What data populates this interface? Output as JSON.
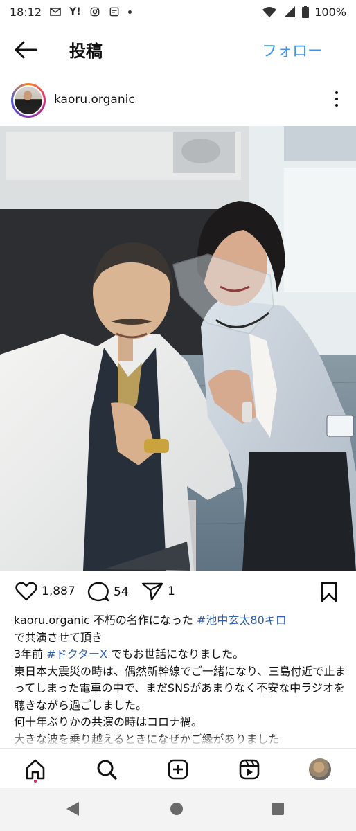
{
  "status_bar": {
    "time": "18:12",
    "battery": "100%",
    "yahoo": "Y!"
  },
  "header": {
    "title": "投稿",
    "follow_label": "フォロー"
  },
  "post": {
    "username": "kaoru.organic",
    "likes": "1,887",
    "comments": "54",
    "shares": "1"
  },
  "caption": {
    "username": "kaoru.organic",
    "line1_text": " 不朽の名作になった ",
    "hashtag1": "#池中玄太80キロ",
    "line2": "で共演させて頂き",
    "line3_prefix": "3年前 ",
    "hashtag2": "#ドクターX",
    "line3_suffix": " でもお世話になりました。",
    "line4": "東日本大震災の時は、偶然新幹線でご一緒になり、三島付近で止まってしまった電車の中で、まだSNSがあまりなく不安な中ラジオを聴きながら過ごしました。",
    "line5": "何十年ぶりかの共演の時はコロナ禍。",
    "line6": "大きな波を乗り越えるときになぜかご縁がありました"
  },
  "colors": {
    "accent": "#3797f0",
    "hashtag": "#2f5fa7",
    "notification_dot": "#e0245e"
  },
  "icons": {
    "back": "arrow-left-icon",
    "more": "more-vertical-icon",
    "like": "heart-icon",
    "comment": "comment-bubble-icon",
    "share": "paper-plane-icon",
    "save": "bookmark-icon",
    "home": "home-icon",
    "search": "search-icon",
    "create": "plus-square-icon",
    "reels": "reels-icon"
  }
}
